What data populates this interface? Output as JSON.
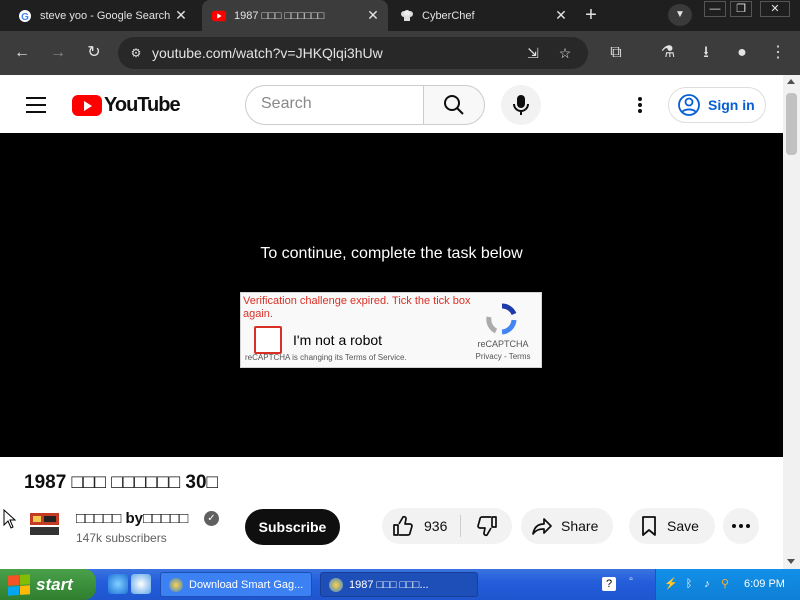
{
  "browser": {
    "tabs": [
      {
        "title": "steve yoo - Google Search",
        "favicon": "google-g-icon",
        "active": false
      },
      {
        "title": "1987 □□□ □□□□□□",
        "favicon": "youtube-icon",
        "active": true
      },
      {
        "title": "CyberChef",
        "favicon": "chef-hat-icon",
        "active": false
      }
    ],
    "url": "youtube.com/watch?v=JHKQlqi3hUw",
    "window_controls": {
      "minimize": "—",
      "restore": "❐",
      "close": "✕"
    }
  },
  "youtube": {
    "logo_text": "YouTube",
    "search_placeholder": "Search",
    "signin_label": "Sign in"
  },
  "player": {
    "message": "To continue, complete the task below",
    "recaptcha": {
      "error": "Verification challenge expired. Tick the tick box again.",
      "checkbox_label": "I'm not a robot",
      "notice": "reCAPTCHA is changing its Terms of Service.",
      "brand": "reCAPTCHA",
      "links": "Privacy - Terms",
      "checked": false
    }
  },
  "video": {
    "title": "1987 □□□ □□□□□□ 30□",
    "channel_name": "□□□□□ by□□□□□",
    "subscribers": "147k subscribers",
    "subscribe_label": "Subscribe",
    "like_count": "936",
    "share_label": "Share",
    "save_label": "Save"
  },
  "taskbar": {
    "start_label": "start",
    "items": [
      {
        "label": "Download Smart Gag...",
        "active": false
      },
      {
        "label": "1987 □□□ □□□...",
        "active": true
      }
    ],
    "clock": "6:09 PM"
  },
  "colors": {
    "youtube_red": "#ff0000",
    "error_red": "#d93025",
    "signin_blue": "#065fd4",
    "taskbar_blue": "#245edb",
    "start_green": "#3c8f3c"
  }
}
